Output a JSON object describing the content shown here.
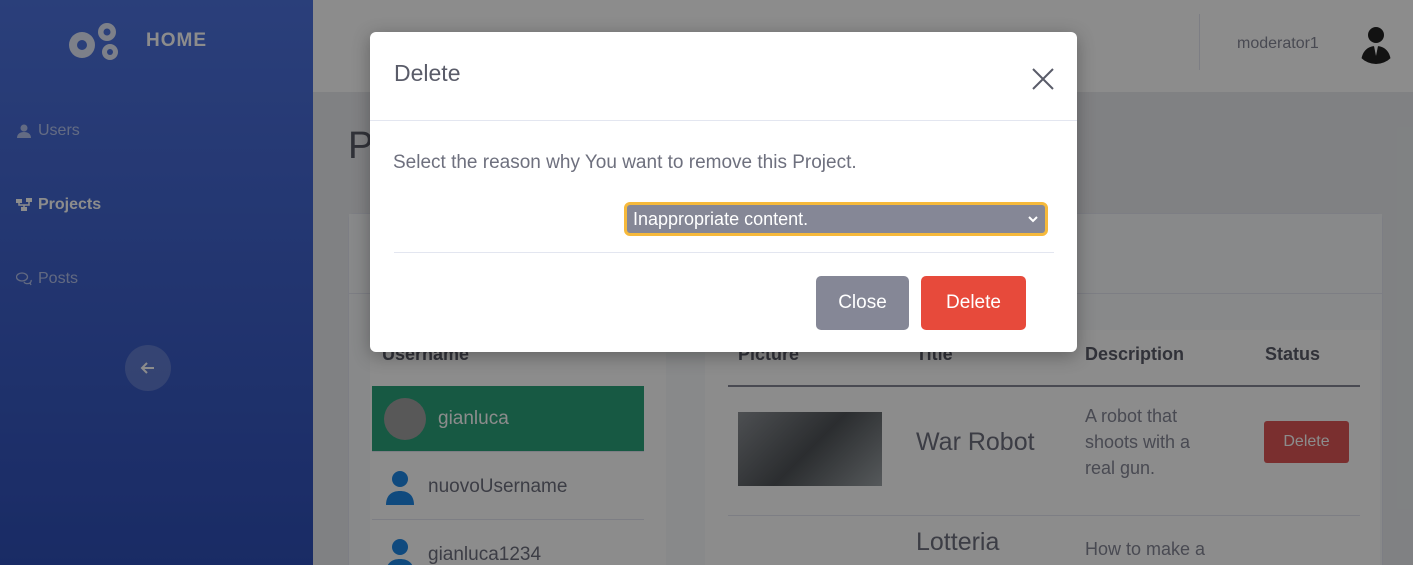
{
  "sidebar": {
    "brand": "HOME",
    "items": [
      {
        "label": "Users",
        "icon": "user-icon"
      },
      {
        "label": "Projects",
        "icon": "project-tree-icon"
      },
      {
        "label": "Posts",
        "icon": "comments-icon"
      }
    ]
  },
  "topbar": {
    "username": "moderator1"
  },
  "page": {
    "title": "P",
    "users_header": "Username",
    "users": [
      {
        "name": "gianluca"
      },
      {
        "name": "nuovoUsername"
      },
      {
        "name": "gianluca1234"
      }
    ],
    "projects_headers": {
      "picture": "Picture",
      "title": "Title",
      "description": "Description",
      "status": "Status"
    },
    "projects": [
      {
        "title": "War Robot",
        "description": [
          "A robot that",
          "shoots with a",
          "real gun."
        ],
        "status_button": "Delete"
      },
      {
        "title": "Lotteria",
        "description": [
          "How to make a"
        ]
      }
    ]
  },
  "modal": {
    "title": "Delete",
    "body": "Select the reason why You want to remove this Project.",
    "selected_reason": "Inappropriate content.",
    "close_label": "Close",
    "delete_label": "Delete"
  },
  "colors": {
    "sidebar": "#4e73df",
    "danger": "#e74a3b",
    "secondary": "#858796",
    "success": "#2aa37a",
    "focus": "#f6b93b"
  }
}
